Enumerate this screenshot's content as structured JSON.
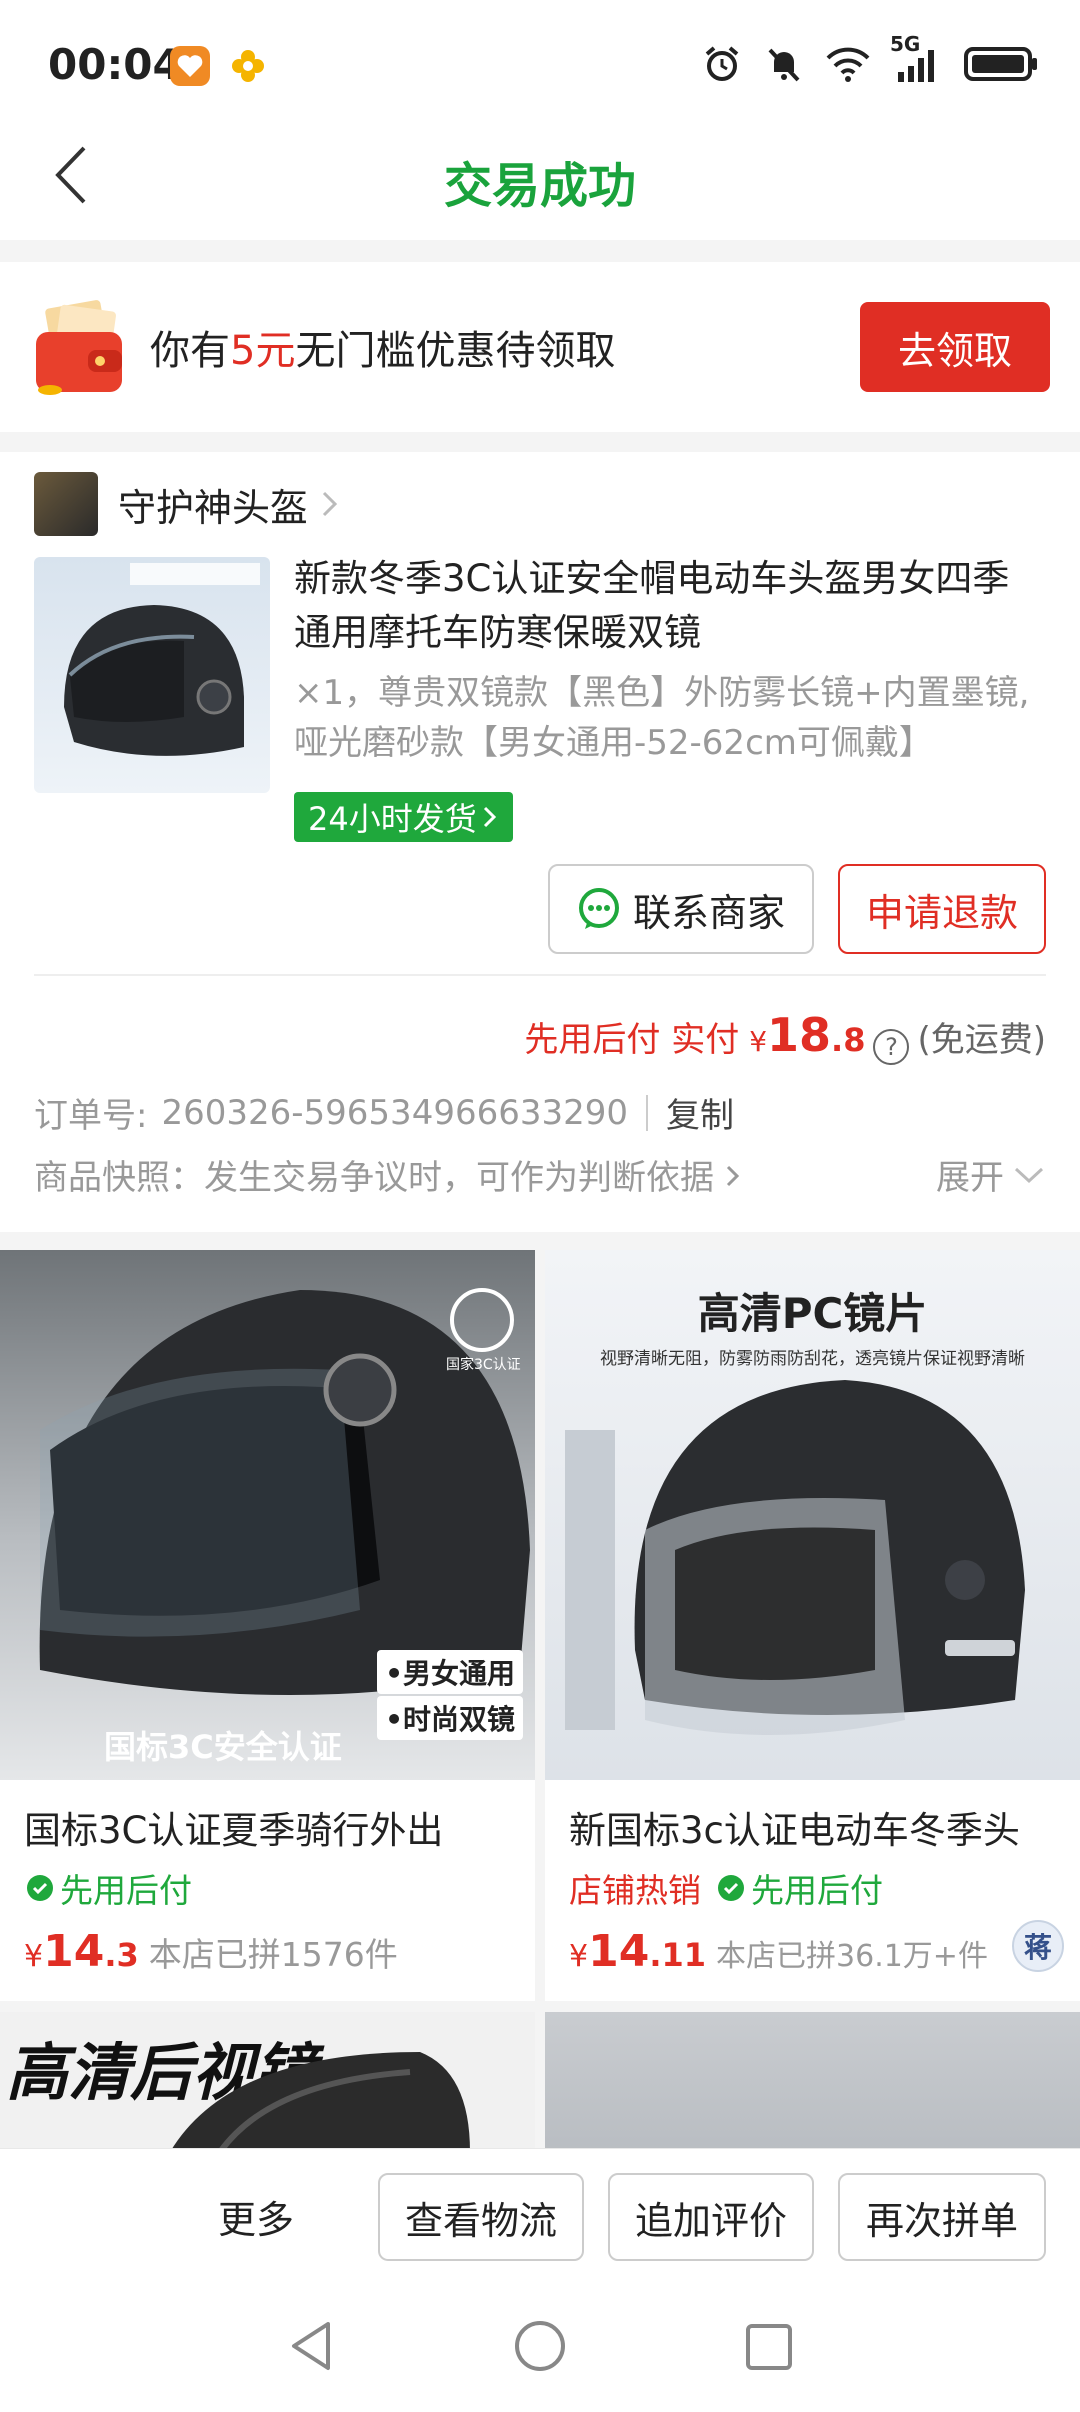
{
  "status_bar": {
    "time": "00:04",
    "network": "5G",
    "icons": [
      "app-orange-heart-icon",
      "app-flower-icon",
      "alarm-icon",
      "mute-icon",
      "wifi-icon",
      "signal-icon",
      "battery-icon"
    ]
  },
  "header": {
    "title": "交易成功",
    "back_icon": "chevron-left-icon",
    "title_color": "#1aa33c"
  },
  "coupon": {
    "text_before": "你有",
    "amount": "5元",
    "text_after": "无门槛优惠待领取",
    "button": "去领取",
    "accent": "#e02e24"
  },
  "order": {
    "shop_name": "守护神头盔",
    "product_title": "新款冬季3C认证安全帽电动车头盔男女四季通用摩托车防寒保暖双镜",
    "product_spec": "×1，尊贵双镜款【黑色】外防雾长镜+内置墨镜,哑光磨砂款【男女通用-52-62cm可佩戴】",
    "ship_tag": "24小时发货",
    "contact_button": "联系商家",
    "refund_button": "申请退款",
    "pay_label": "先用后付 实付",
    "pay_currency": "¥",
    "pay_int": "18",
    "pay_dec": ".8",
    "pay_help": "?",
    "pay_note": "(免运费)",
    "order_no_label": "订单号:",
    "order_no": "260326-596534966633290",
    "copy": "复制",
    "snapshot_text": "商品快照：发生交易争议时，可作为判断依据",
    "expand": "展开"
  },
  "recommendations": [
    {
      "title": "国标3C认证夏季骑行外出",
      "tags": [
        {
          "text": "先用后付",
          "type": "green"
        }
      ],
      "currency": "¥",
      "price_int": "14",
      "price_dec": ".3",
      "sold": "本店已拼1576件",
      "image_caption": "国标3C安全认证",
      "image_badge_1": "•男女通用",
      "image_badge_2": "•时尚双镜",
      "image_logo": "国家3C认证"
    },
    {
      "title": "新国标3c认证电动车冬季头",
      "tags": [
        {
          "text": "店铺热销",
          "type": "red"
        },
        {
          "text": "先用后付",
          "type": "green"
        }
      ],
      "currency": "¥",
      "price_int": "14",
      "price_dec": ".11",
      "sold": "本店已拼36.1万+件",
      "image_caption": "高清PC镜片",
      "image_sub": "视野清晰无阻，防雾防雨防刮花，透亮镜片保证视野清晰",
      "avatar_text": "蒋"
    },
    {
      "image_caption": "高清后视镜"
    },
    {
      "image_caption": ""
    }
  ],
  "bottom_bar": {
    "more": "更多",
    "buttons": [
      "查看物流",
      "追加评价",
      "再次拼单"
    ]
  },
  "nav_bar": {
    "icons": [
      "back-triangle-icon",
      "home-circle-icon",
      "recents-square-icon"
    ]
  }
}
